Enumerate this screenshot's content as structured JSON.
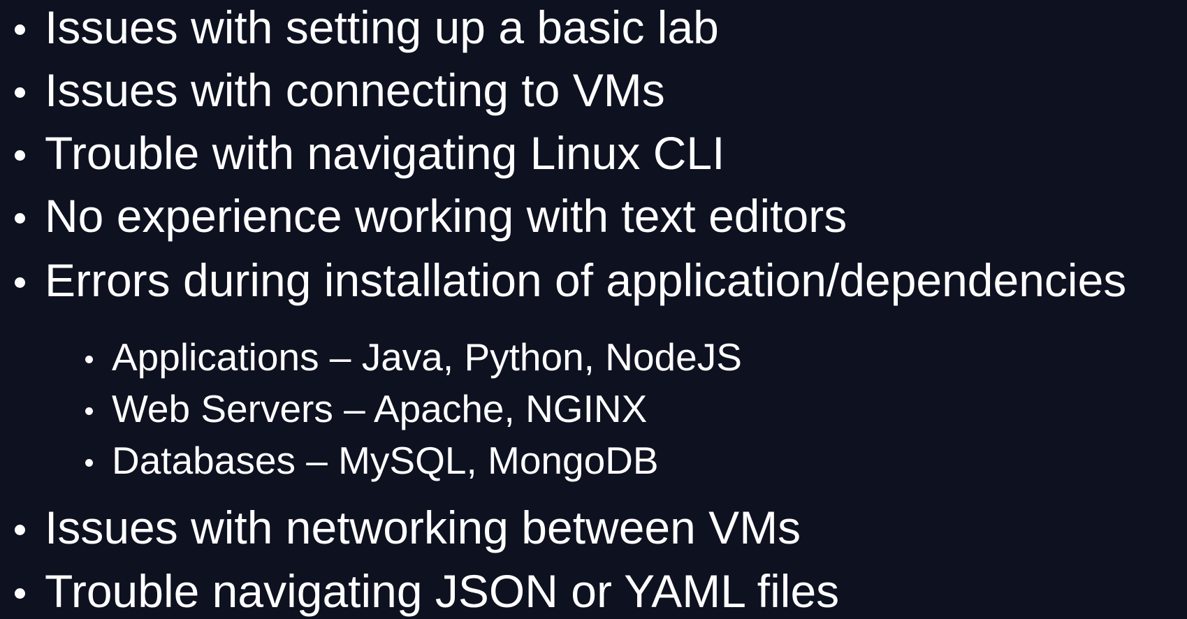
{
  "bullets": [
    {
      "text": "Issues with setting up a basic lab",
      "level": 1
    },
    {
      "text": "Issues with connecting to VMs",
      "level": 1
    },
    {
      "text": "Trouble with navigating Linux CLI",
      "level": 1
    },
    {
      "text": "No experience working with text editors",
      "level": 1
    },
    {
      "text": "Errors during installation of application/dependencies",
      "level": 1
    },
    {
      "text": "Applications – Java, Python, NodeJS",
      "level": 2
    },
    {
      "text": "Web Servers – Apache, NGINX",
      "level": 2
    },
    {
      "text": "Databases – MySQL, MongoDB",
      "level": 2
    },
    {
      "text": "Issues with networking between VMs",
      "level": 1
    },
    {
      "text": "Trouble navigating JSON or YAML files",
      "level": 1
    }
  ],
  "colors": {
    "background": "#0e1120",
    "text": "#ffffff"
  }
}
